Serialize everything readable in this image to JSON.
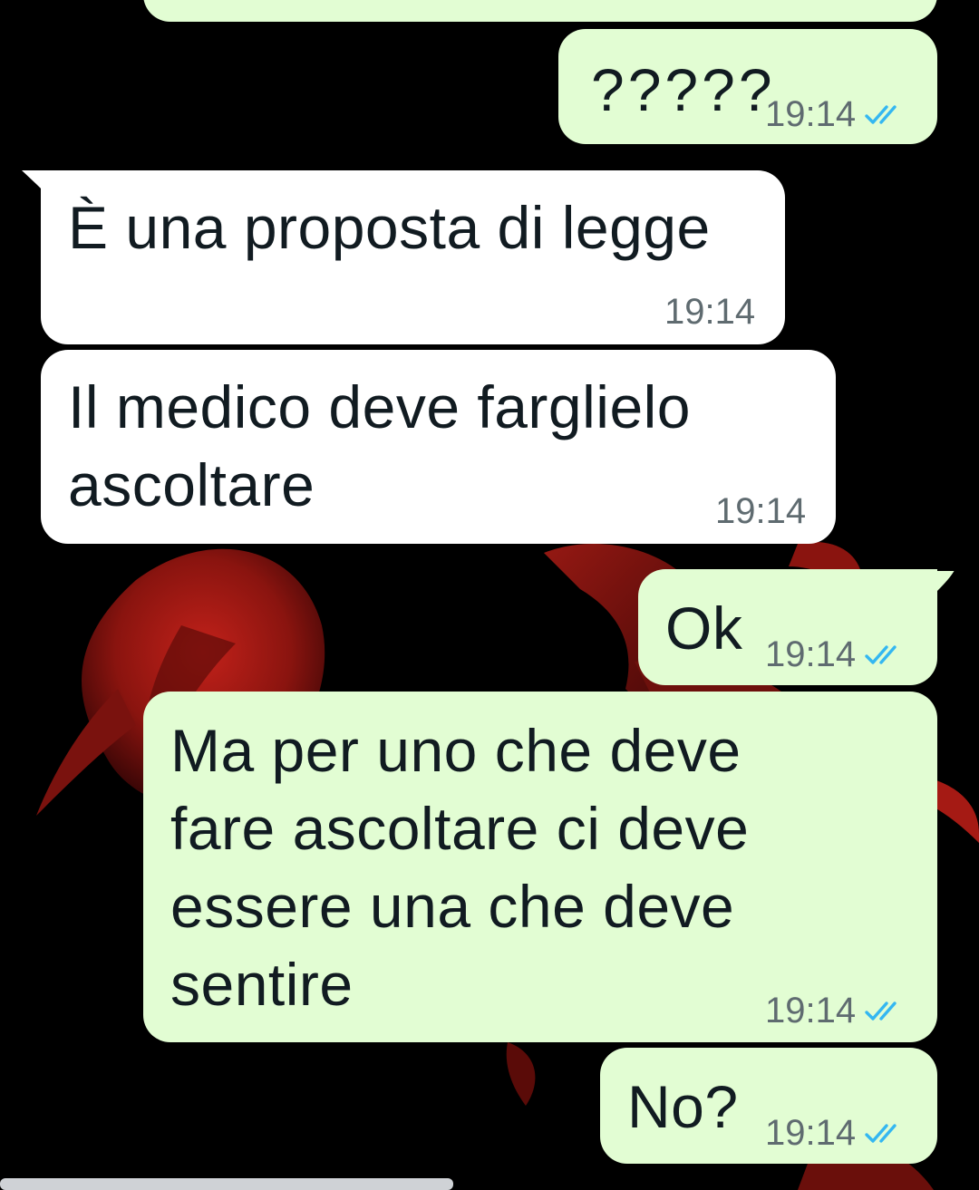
{
  "colors": {
    "outgoing_bubble": "#e2fdd3",
    "incoming_bubble": "#ffffff",
    "text": "#111b21",
    "timestamp": "#5f6b70",
    "read_tick": "#34b7f1",
    "wallpaper": "#000000"
  },
  "messages": [
    {
      "direction": "outgoing",
      "text": "?????",
      "time": "19:14",
      "status": "read"
    },
    {
      "direction": "incoming",
      "text": "È una proposta di legge",
      "time": "19:14"
    },
    {
      "direction": "incoming",
      "text": "Il medico deve farglielo\nascoltare",
      "time": "19:14"
    },
    {
      "direction": "outgoing",
      "text": "Ok",
      "time": "19:14",
      "status": "read"
    },
    {
      "direction": "outgoing",
      "text": "Ma per uno che deve\nfare ascoltare ci deve\nessere una che deve\nsentire",
      "time": "19:14",
      "status": "read"
    },
    {
      "direction": "outgoing",
      "text": "No?",
      "time": "19:14",
      "status": "read"
    }
  ],
  "icons": {
    "read_receipt": "double-check-icon"
  }
}
